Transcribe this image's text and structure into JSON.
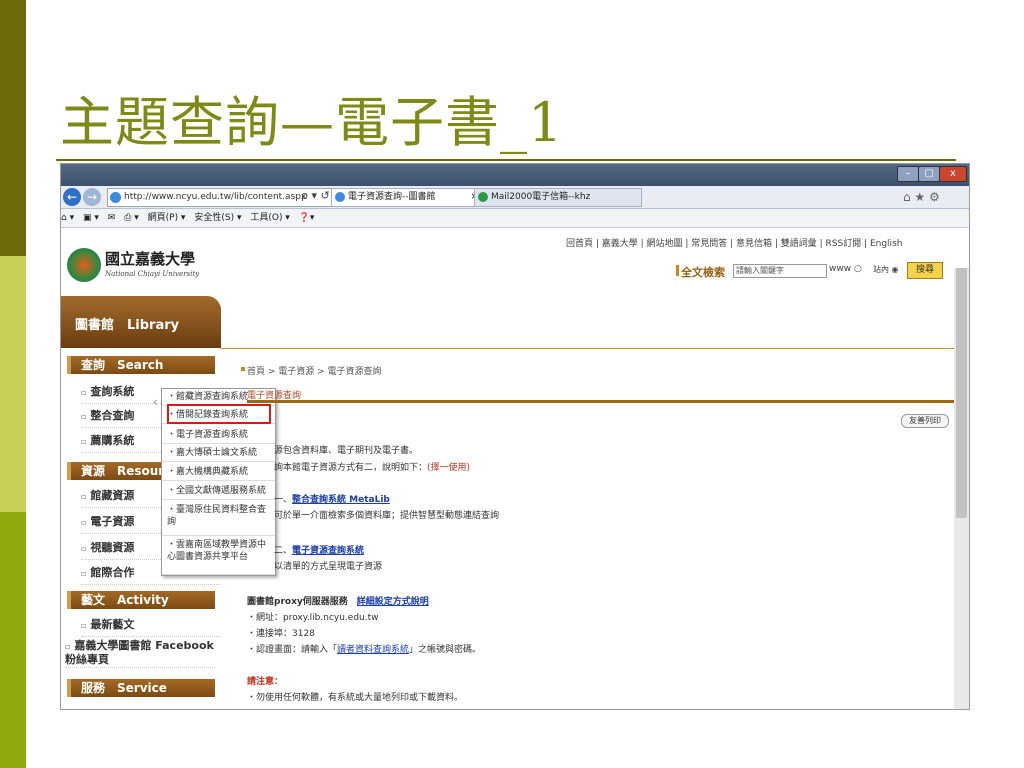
{
  "slide": {
    "title": "主題查詢—電子書_1"
  },
  "browser": {
    "url": "http://www.ncyu.edu.tw/lib/content.aspx",
    "url_controls": "ρ ▾ ↺",
    "tabs": [
      {
        "label": "電子資源查詢--圖書館",
        "close": "×"
      },
      {
        "label": "Mail2000電子信箱--khz"
      }
    ],
    "window_buttons": {
      "min": "–",
      "max": "▢",
      "close": "x"
    },
    "topright_icons": "⌂ ★ ⚙",
    "command_bar": [
      "⌂ ▾",
      "▣ ▾",
      "✉",
      "⎙ ▾",
      "網頁(P) ▾",
      "安全性(S) ▾",
      "工具(O) ▾",
      "❓▾"
    ]
  },
  "sidebar": {
    "logo_text": "國立嘉義大學",
    "logo_sub": "National Chiayi University",
    "library_title": "圖書館　Library",
    "sections": [
      {
        "head": "查詢　Search",
        "items": [
          "查詢系統",
          "整合查詢",
          "薦購系統"
        ]
      },
      {
        "head": "資源　Resources",
        "items": [
          "館藏資源",
          "電子資源",
          "視聽資源",
          "館際合作"
        ]
      },
      {
        "head": "藝文　Activity",
        "items": [
          "最新藝文",
          "嘉義大學圖書館 Facebook粉絲專頁"
        ]
      },
      {
        "head": "服務　Service",
        "items": []
      }
    ],
    "item_marker": "▫"
  },
  "dropdown": {
    "caret": "‹",
    "items": [
      "・館藏資源查詢系統",
      "・借閱記錄查詢系統",
      "・電子資源查詢系統",
      "・嘉大博碩士論文系統",
      "・嘉大機構典藏系統",
      "・全國文獻傳遞服務系統",
      "・臺灣原住民資料整合查詢",
      "・雲嘉南區域教學資源中心圖書資源共享平台"
    ]
  },
  "header": {
    "toplinks": "回首頁 | 嘉義大學 | 網站地圖 | 常見問答 | 意見信箱 | 雙語詞彙 | RSS訂閱 | English",
    "search_label": "全文檢索",
    "search_placeholder": "請輸入關鍵字",
    "scope_www": "www ○",
    "scope_site": "站內 ◉",
    "search_button": "搜尋"
  },
  "content": {
    "breadcrumb": "首頁 > 電子資源 > 電子資源查詢",
    "section_title": "電子資源查詢",
    "print": "友善列印",
    "intro1": "源包含資料庫、電子期刊及電子書。",
    "intro2_a": "詢本館電子資源方式有二，說明如下：",
    "intro2_b": "(擇一使用)",
    "m1_prefix": "一、",
    "m1_link": "整合查詢系統 MetaLib",
    "m1_desc": "可於單一介面檢索多個資料庫；提供智慧型動態連結查詢",
    "m2_prefix": "二、",
    "m2_link": "電子資源查詢系統",
    "m2_desc": "以清單的方式呈現電子資源",
    "proxy_title": "圖書館proxy伺服器服務",
    "proxy_link": "詳細設定方式說明",
    "proxy_addr": "・網址：proxy.lib.ncyu.edu.tw",
    "proxy_port": "・連接埠：3128",
    "proxy_auth_a": "・認證畫面：請輸入「",
    "proxy_auth_link": "讀者資料查詢系統",
    "proxy_auth_b": "」之帳號與密碼。",
    "notice_title": "請注意：",
    "notice1": "・勿使用任何軟體，有系統或大量地列印或下載資料。"
  }
}
